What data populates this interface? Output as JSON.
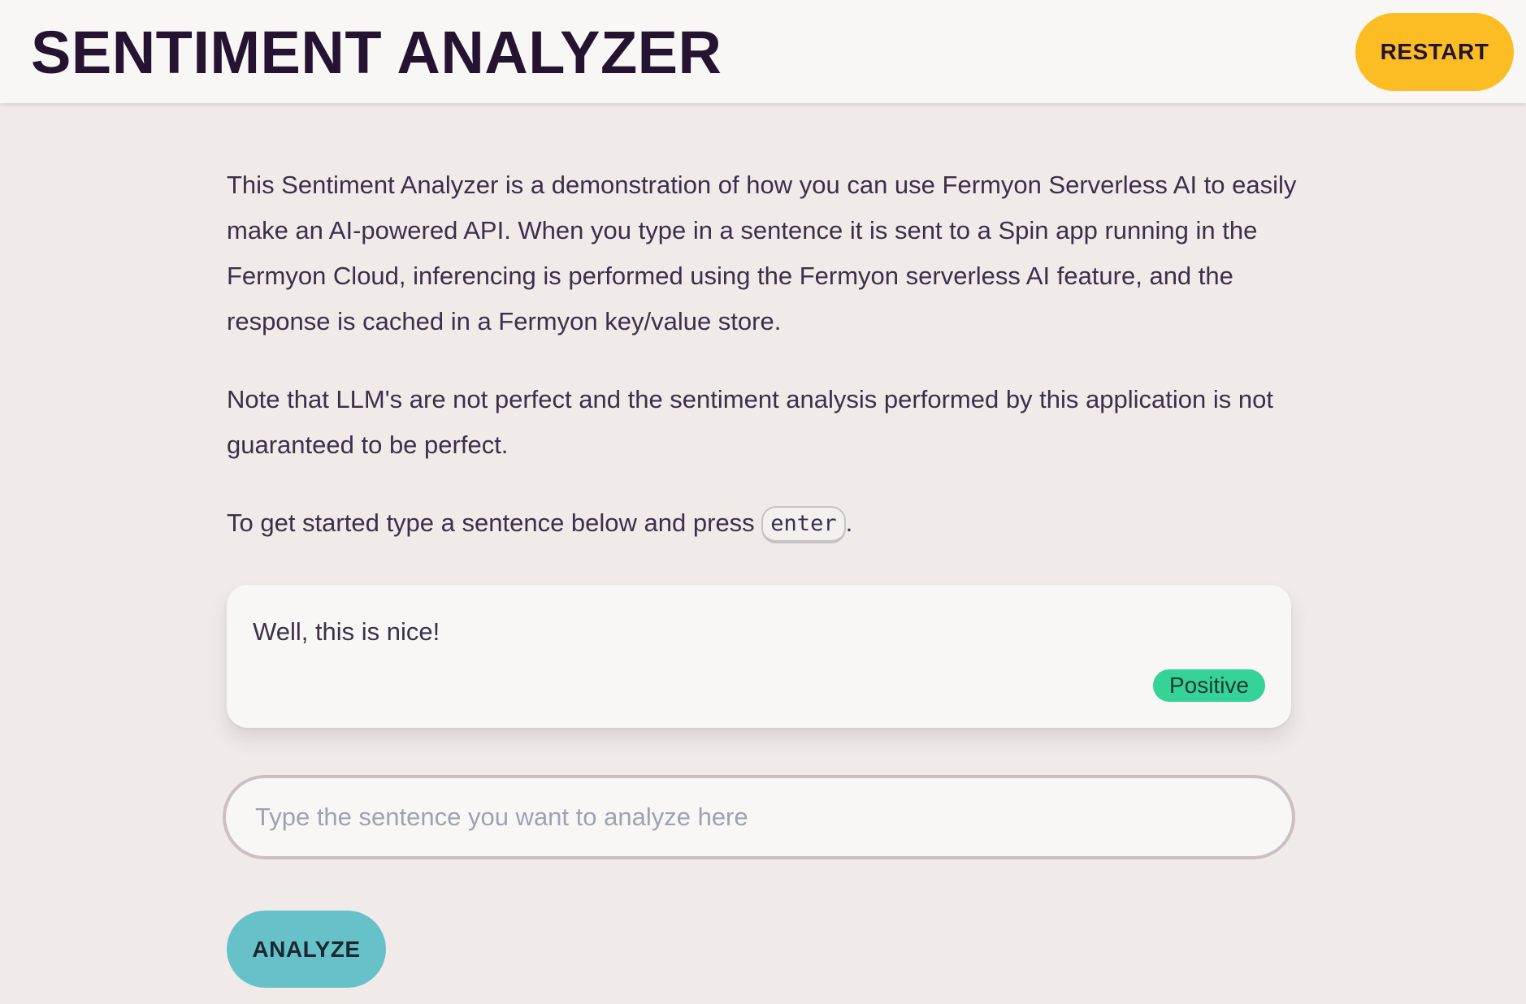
{
  "header": {
    "title": "SENTIMENT ANALYZER",
    "restart_label": "RESTART"
  },
  "intro": {
    "paragraph1": "This Sentiment Analyzer is a demonstration of how you can use Fermyon Serverless AI to easily make an AI-powered API. When you type in a sentence it is sent to a Spin app running in the Fermyon Cloud, inferencing is performed using the Fermyon serverless AI feature, and the response is cached in a Fermyon key/value store.",
    "paragraph2": "Note that LLM's are not perfect and the sentiment analysis performed by this application is not guaranteed to be perfect.",
    "paragraph3_before": "To get started type a sentence below and press ",
    "paragraph3_key": "enter",
    "paragraph3_after": "."
  },
  "result": {
    "sentence": "Well, this is nice!",
    "sentiment": "Positive"
  },
  "input": {
    "value": "",
    "placeholder": "Type the sentence you want to analyze here"
  },
  "actions": {
    "analyze_label": "ANALYZE"
  },
  "colors": {
    "page_background": "#f0ebe9",
    "header_background": "#f9f7f5",
    "title_text": "#241432",
    "restart_button": "#fbbd23",
    "positive_badge": "#36d399",
    "analyze_button": "#67c1c9"
  }
}
